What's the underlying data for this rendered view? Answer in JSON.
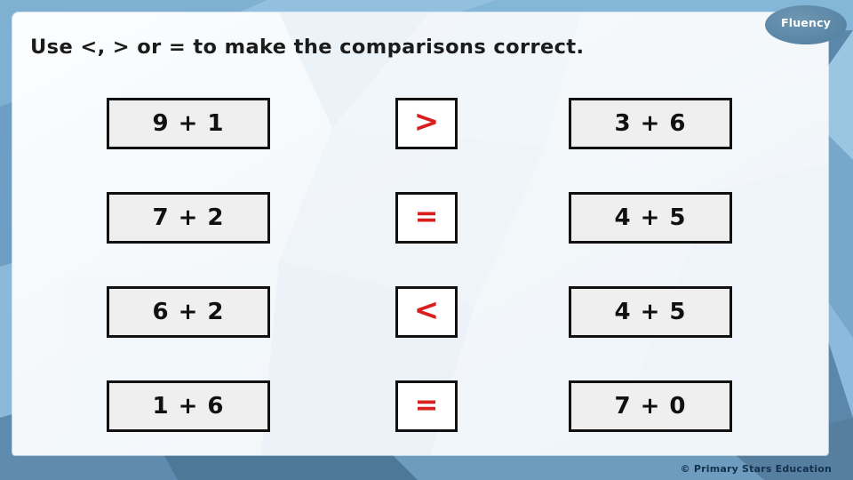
{
  "slide": {
    "heading": "Use <, > or = to make the comparisons correct.",
    "badge_label": "Fluency",
    "footer_credit": "© Primary Stars Education"
  },
  "colors": {
    "frame_blue": "#5b87ab",
    "frame_light_blue": "#8fbcdc",
    "card_white": "#f7fafc",
    "box_fill": "#efefef",
    "box_border": "#111111",
    "symbol_red": "#d81e1e",
    "badge_blue": "#5d89a8",
    "footer_text": "#13314d"
  },
  "rows": [
    {
      "left": "9 + 1",
      "symbol": ">",
      "symbol_name": "greater-than",
      "right": "3 + 6"
    },
    {
      "left": "7 + 2",
      "symbol": "=",
      "symbol_name": "equals",
      "right": "4 + 5"
    },
    {
      "left": "6 + 2",
      "symbol": "<",
      "symbol_name": "less-than",
      "right": "4 + 5"
    },
    {
      "left": "1 + 6",
      "symbol": "=",
      "symbol_name": "equals",
      "right": "7 + 0"
    }
  ]
}
